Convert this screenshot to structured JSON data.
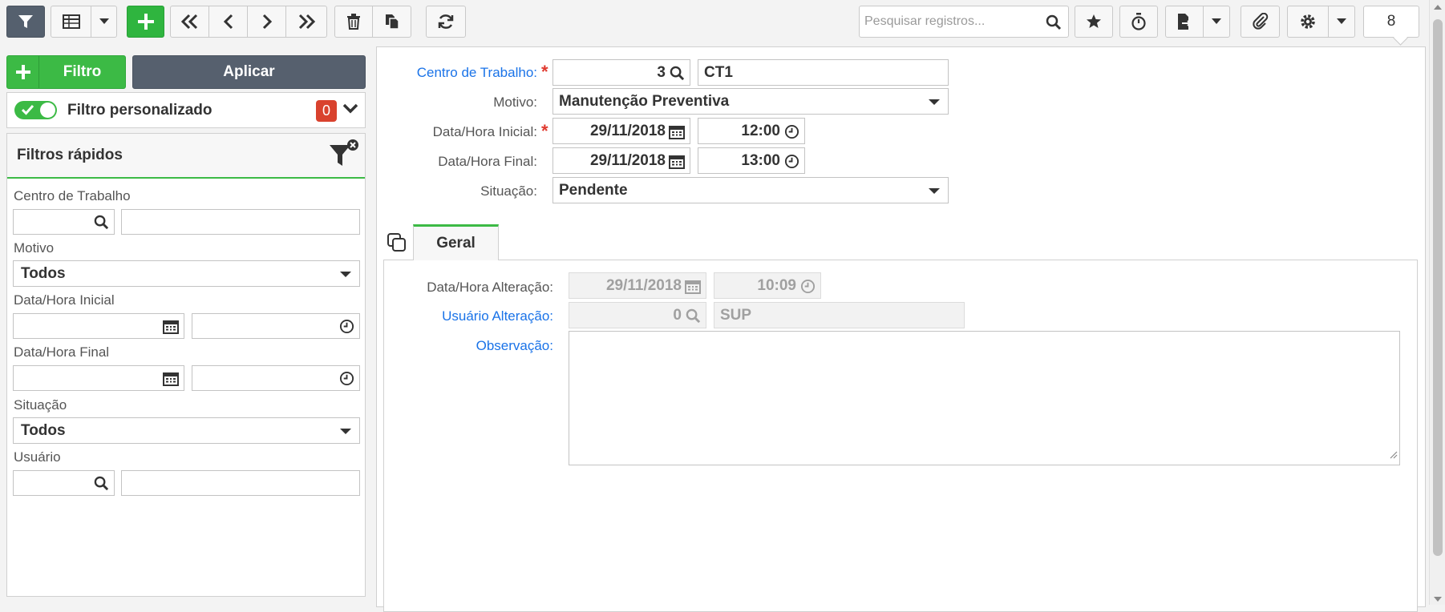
{
  "toolbar": {
    "icons": [
      "filter-icon",
      "grid-icon",
      "chevron-down-icon",
      "plus-icon",
      "first-record-icon",
      "previous-record-icon",
      "next-record-icon",
      "last-record-icon",
      "trash-icon",
      "copy-icon",
      "refresh-icon",
      "search-icon",
      "star-icon",
      "stopwatch-icon",
      "export-icon",
      "paperclip-icon",
      "gear-icon"
    ],
    "search_placeholder": "Pesquisar registros...",
    "record_count": "8"
  },
  "filter_panel": {
    "new_filter_label": "Filtro",
    "apply_label": "Aplicar",
    "custom_filter_label": "Filtro personalizado",
    "custom_filter_enabled": true,
    "custom_filter_count": "0",
    "quick_filters_title": "Filtros rápidos",
    "fields": {
      "centro_label": "Centro de Trabalho",
      "motivo_label": "Motivo",
      "motivo_value": "Todos",
      "data_inicial_label": "Data/Hora Inicial",
      "data_final_label": "Data/Hora Final",
      "situacao_label": "Situação",
      "situacao_value": "Todos",
      "usuario_label": "Usuário"
    }
  },
  "form": {
    "centro_label": "Centro de Trabalho:",
    "centro_code": "3",
    "centro_name": "CT1",
    "motivo_label": "Motivo:",
    "motivo_value": "Manutenção Preventiva",
    "data_inicial_label": "Data/Hora Inicial:",
    "data_inicial_date": "29/11/2018",
    "data_inicial_time": "12:00",
    "data_final_label": "Data/Hora Final:",
    "data_final_date": "29/11/2018",
    "data_final_time": "13:00",
    "situacao_label": "Situação:",
    "situacao_value": "Pendente"
  },
  "tabs": [
    {
      "label": "Geral",
      "active": true
    }
  ],
  "geral": {
    "alteracao_label": "Data/Hora Alteração:",
    "alteracao_date": "29/11/2018",
    "alteracao_time": "10:09",
    "usuario_label": "Usuário Alteração:",
    "usuario_code": "0",
    "usuario_name": "SUP",
    "observacao_label": "Observação:",
    "observacao_value": ""
  },
  "colors": {
    "accent_green": "#3cba45",
    "dark_button": "#56606e",
    "link_blue": "#1a73e8",
    "badge_red": "#d9422e",
    "required_red": "#e03a2f"
  }
}
